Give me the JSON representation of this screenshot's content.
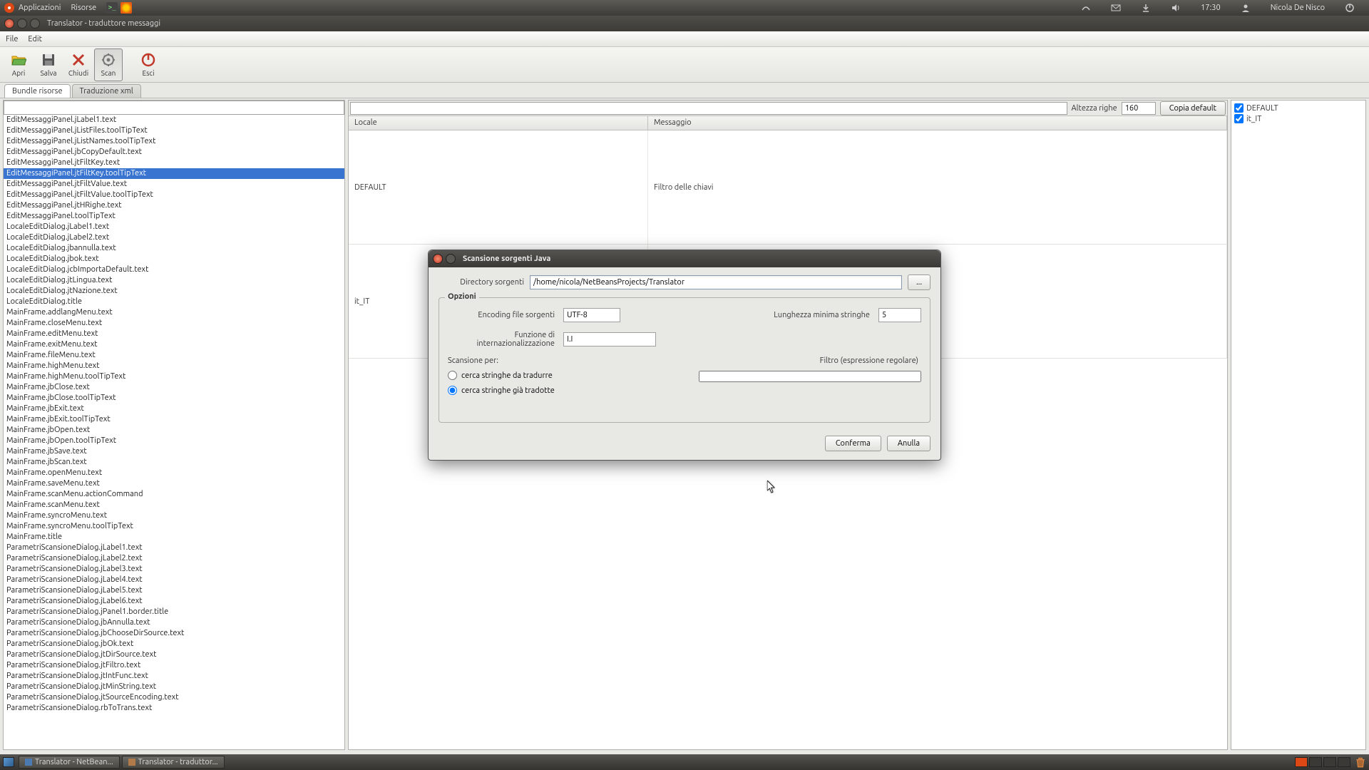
{
  "top_panel": {
    "apps_label": "Applicazioni",
    "places_label": "Risorse",
    "time": "17:30",
    "user": "Nicola De Nisco"
  },
  "window": {
    "title": "Translator - traduttore messaggi"
  },
  "menu": {
    "file": "File",
    "edit": "Edit"
  },
  "toolbar": {
    "apri": "Apri",
    "salva": "Salva",
    "chiudi": "Chiudi",
    "scan": "Scan",
    "esci": "Esci"
  },
  "tabs": {
    "bundle": "Bundle risorse",
    "xml": "Traduzione xml"
  },
  "center": {
    "row_height_label": "Altezza righe",
    "row_height_value": "160",
    "copy_default": "Copia default",
    "col_locale": "Locale",
    "col_message": "Messaggio",
    "rows": [
      {
        "locale": "DEFAULT",
        "msg": "Filtro delle chiavi"
      },
      {
        "locale": "it_IT",
        "msg": ""
      }
    ]
  },
  "right_panel": {
    "default": "DEFAULT",
    "it": "it_IT"
  },
  "keys": [
    "EditMessaggiPanel.jLabel1.text",
    "EditMessaggiPanel.jListFiles.toolTipText",
    "EditMessaggiPanel.jListNames.toolTipText",
    "EditMessaggiPanel.jbCopyDefault.text",
    "EditMessaggiPanel.jtFiltKey.text",
    "EditMessaggiPanel.jtFiltKey.toolTipText",
    "EditMessaggiPanel.jtFiltValue.text",
    "EditMessaggiPanel.jtFiltValue.toolTipText",
    "EditMessaggiPanel.jtHRighe.text",
    "EditMessaggiPanel.toolTipText",
    "LocaleEditDialog.jLabel1.text",
    "LocaleEditDialog.jLabel2.text",
    "LocaleEditDialog.jbannulla.text",
    "LocaleEditDialog.jbok.text",
    "LocaleEditDialog.jcbImportaDefault.text",
    "LocaleEditDialog.jtLingua.text",
    "LocaleEditDialog.jtNazione.text",
    "LocaleEditDialog.title",
    "MainFrame.addlangMenu.text",
    "MainFrame.closeMenu.text",
    "MainFrame.editMenu.text",
    "MainFrame.exitMenu.text",
    "MainFrame.fileMenu.text",
    "MainFrame.highMenu.text",
    "MainFrame.highMenu.toolTipText",
    "MainFrame.jbClose.text",
    "MainFrame.jbClose.toolTipText",
    "MainFrame.jbExit.text",
    "MainFrame.jbExit.toolTipText",
    "MainFrame.jbOpen.text",
    "MainFrame.jbOpen.toolTipText",
    "MainFrame.jbSave.text",
    "MainFrame.jbScan.text",
    "MainFrame.openMenu.text",
    "MainFrame.saveMenu.text",
    "MainFrame.scanMenu.actionCommand",
    "MainFrame.scanMenu.text",
    "MainFrame.syncroMenu.text",
    "MainFrame.syncroMenu.toolTipText",
    "MainFrame.title",
    "ParametriScansioneDialog.jLabel1.text",
    "ParametriScansioneDialog.jLabel2.text",
    "ParametriScansioneDialog.jLabel3.text",
    "ParametriScansioneDialog.jLabel4.text",
    "ParametriScansioneDialog.jLabel5.text",
    "ParametriScansioneDialog.jLabel6.text",
    "ParametriScansioneDialog.jPanel1.border.title",
    "ParametriScansioneDialog.jbAnnulla.text",
    "ParametriScansioneDialog.jbChooseDirSource.text",
    "ParametriScansioneDialog.jbOk.text",
    "ParametriScansioneDialog.jtDirSource.text",
    "ParametriScansioneDialog.jtFiltro.text",
    "ParametriScansioneDialog.jtIntFunc.text",
    "ParametriScansioneDialog.jtMinString.text",
    "ParametriScansioneDialog.jtSourceEncoding.text",
    "ParametriScansioneDialog.rbToTrans.text"
  ],
  "selected_key_index": 5,
  "dialog": {
    "title": "Scansione sorgenti Java",
    "dir_label": "Directory sorgenti",
    "dir_value": "/home/nicola/NetBeansProjects/Translator",
    "browse": "...",
    "opts_legend": "Opzioni",
    "enc_label": "Encoding file sorgenti",
    "enc_value": "UTF-8",
    "minlen_label": "Lunghezza minima stringhe",
    "minlen_value": "5",
    "func_label": "Funzione di internazionalizzazione",
    "func_value": "I.I",
    "scan_for": "Scansione per:",
    "filter_label": "Filtro (espressione regolare)",
    "radio1": "cerca stringhe da tradurre",
    "radio2": "cerca stringhe già tradotte",
    "confirm": "Conferma",
    "cancel": "Anulla"
  },
  "taskbar": {
    "item1": "Translator - NetBean...",
    "item2": "Translator - traduttor..."
  }
}
